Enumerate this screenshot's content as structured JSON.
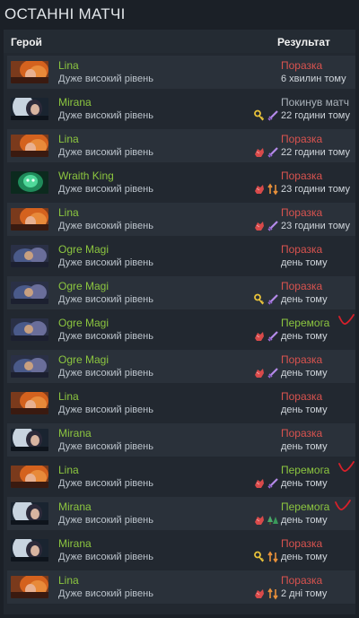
{
  "page": {
    "title": "ОСТАННІ МАТЧІ"
  },
  "table": {
    "col_hero": "Герой",
    "col_result": "Результат"
  },
  "colors": {
    "win": "#8cc63f",
    "loss": "#d9534f",
    "hero_name": "#8cc63f"
  },
  "matches": [
    {
      "hero": "Lina",
      "skill": "Дуже високий рівень",
      "result": "Поразка",
      "outcome": "loss",
      "when": "6 хвилин тому",
      "portrait": "lina",
      "icons": [],
      "mark": false
    },
    {
      "hero": "Mirana",
      "skill": "Дуже високий рівень",
      "result": "Покинув матч",
      "outcome": "abandon",
      "when": "22 години тому",
      "portrait": "mirana",
      "icons": [
        "key-icon",
        "sword-icon"
      ],
      "mark": false
    },
    {
      "hero": "Lina",
      "skill": "Дуже високий рівень",
      "result": "Поразка",
      "outcome": "loss",
      "when": "22 години тому",
      "portrait": "lina",
      "icons": [
        "fist-icon",
        "sword-icon"
      ],
      "mark": false
    },
    {
      "hero": "Wraith King",
      "skill": "Дуже високий рівень",
      "result": "Поразка",
      "outcome": "loss",
      "when": "23 години тому",
      "portrait": "wraith",
      "icons": [
        "fist-icon",
        "arrows-icon"
      ],
      "mark": false
    },
    {
      "hero": "Lina",
      "skill": "Дуже високий рівень",
      "result": "Поразка",
      "outcome": "loss",
      "when": "23 години тому",
      "portrait": "lina",
      "icons": [
        "fist-icon",
        "sword-icon"
      ],
      "mark": false
    },
    {
      "hero": "Ogre Magi",
      "skill": "Дуже високий рівень",
      "result": "Поразка",
      "outcome": "loss",
      "when": "день тому",
      "portrait": "ogre",
      "icons": [],
      "mark": false
    },
    {
      "hero": "Ogre Magi",
      "skill": "Дуже високий рівень",
      "result": "Поразка",
      "outcome": "loss",
      "when": "день тому",
      "portrait": "ogre",
      "icons": [
        "key-icon",
        "sword-icon"
      ],
      "mark": false
    },
    {
      "hero": "Ogre Magi",
      "skill": "Дуже високий рівень",
      "result": "Перемога",
      "outcome": "win",
      "when": "день тому",
      "portrait": "ogre",
      "icons": [
        "fist-icon",
        "sword-icon"
      ],
      "mark": true
    },
    {
      "hero": "Ogre Magi",
      "skill": "Дуже високий рівень",
      "result": "Поразка",
      "outcome": "loss",
      "when": "день тому",
      "portrait": "ogre",
      "icons": [
        "fist-icon",
        "sword-icon"
      ],
      "mark": false
    },
    {
      "hero": "Lina",
      "skill": "Дуже високий рівень",
      "result": "Поразка",
      "outcome": "loss",
      "when": "день тому",
      "portrait": "lina",
      "icons": [],
      "mark": false
    },
    {
      "hero": "Mirana",
      "skill": "Дуже високий рівень",
      "result": "Поразка",
      "outcome": "loss",
      "when": "день тому",
      "portrait": "mirana",
      "icons": [],
      "mark": false
    },
    {
      "hero": "Lina",
      "skill": "Дуже високий рівень",
      "result": "Перемога",
      "outcome": "win",
      "when": "день тому",
      "portrait": "lina",
      "icons": [
        "fist-icon",
        "sword-icon"
      ],
      "mark": true
    },
    {
      "hero": "Mirana",
      "skill": "Дуже високий рівень",
      "result": "Перемога",
      "outcome": "win",
      "when": "день тому",
      "portrait": "mirana",
      "icons": [
        "fist-icon",
        "tree-icon"
      ],
      "mark": true
    },
    {
      "hero": "Mirana",
      "skill": "Дуже високий рівень",
      "result": "Поразка",
      "outcome": "loss",
      "when": "день тому",
      "portrait": "mirana",
      "icons": [
        "key-icon",
        "arrows-icon"
      ],
      "mark": false
    },
    {
      "hero": "Lina",
      "skill": "Дуже високий рівень",
      "result": "Поразка",
      "outcome": "loss",
      "when": "2 дні тому",
      "portrait": "lina",
      "icons": [
        "fist-icon",
        "arrows-icon"
      ],
      "mark": false
    }
  ]
}
